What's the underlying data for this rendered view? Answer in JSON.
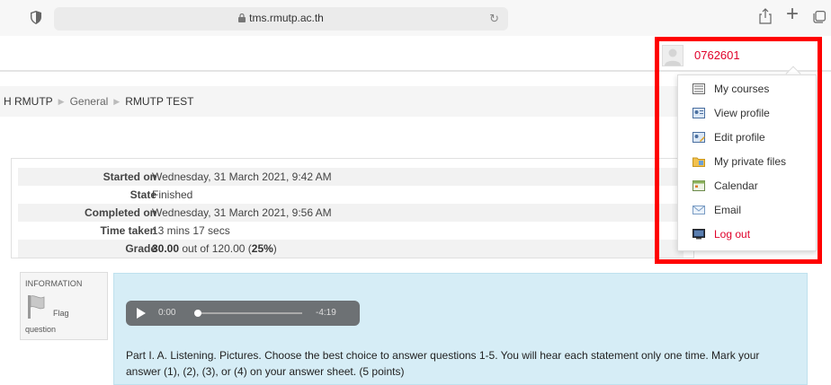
{
  "browser": {
    "url": "tms.rmutp.ac.th"
  },
  "user": {
    "id": "0762601"
  },
  "breadcrumb": {
    "items": [
      "H RMUTP",
      "General",
      "RMUTP TEST"
    ]
  },
  "summary": {
    "rows": [
      {
        "label": "Started on",
        "value": "Wednesday, 31 March 2021, 9:42 AM"
      },
      {
        "label": "State",
        "value": "Finished"
      },
      {
        "label": "Completed on",
        "value": "Wednesday, 31 March 2021, 9:56 AM"
      },
      {
        "label": "Time taken",
        "value": "13 mins 17 secs"
      }
    ],
    "grade": {
      "label": "Grade",
      "score": "30.00",
      "out_of_text": " out of 120.00 (",
      "percent": "25%",
      "close": ")"
    }
  },
  "question": {
    "type": "INFORMATION",
    "flag_label": "Flag",
    "flag_label2": "question",
    "audio": {
      "current": "0:00",
      "remaining": "-4:19"
    },
    "text": "Part I. A. Listening.  Pictures. Choose the best choice to answer questions 1-5.  You will hear each statement only one time.  Mark your answer (1), (2), (3), or (4) on your answer sheet. (5 points)"
  },
  "menu": {
    "items": [
      {
        "label": "My courses",
        "icon": "courses-icon"
      },
      {
        "label": "View profile",
        "icon": "profile-icon"
      },
      {
        "label": "Edit profile",
        "icon": "edit-profile-icon"
      },
      {
        "label": "My private files",
        "icon": "folder-icon"
      },
      {
        "label": "Calendar",
        "icon": "calendar-icon"
      },
      {
        "label": "Email",
        "icon": "email-icon"
      },
      {
        "label": "Log out",
        "icon": "logout-icon"
      }
    ]
  },
  "colors": {
    "accent": "#e0002a",
    "annotation": "#ff0000",
    "question_bg": "#d6edf6"
  }
}
